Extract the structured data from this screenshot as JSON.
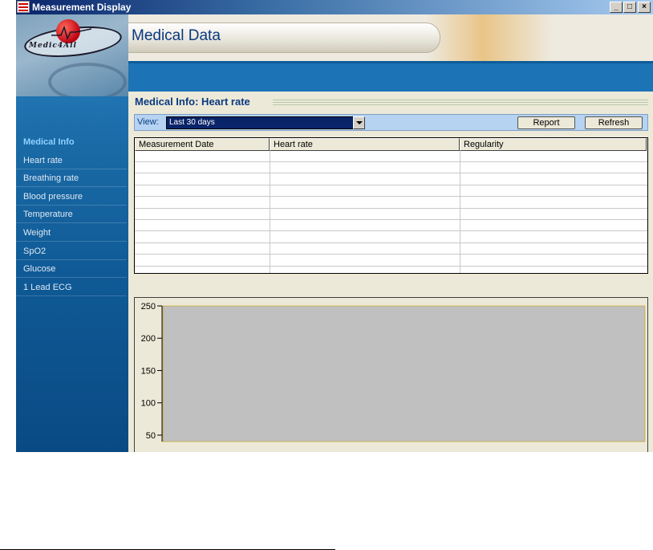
{
  "window": {
    "title": "Measurement Display",
    "controls": {
      "minimize": "_",
      "maximize": "□",
      "close": "×"
    }
  },
  "logo": {
    "text": "Medic4All"
  },
  "sidebar": {
    "items": [
      {
        "label": "Medical Info",
        "active": true
      },
      {
        "label": "Heart rate"
      },
      {
        "label": "Breathing rate"
      },
      {
        "label": "Blood pressure"
      },
      {
        "label": "Temperature"
      },
      {
        "label": "Weight"
      },
      {
        "label": "SpO2"
      },
      {
        "label": "Glucose"
      },
      {
        "label": "1 Lead ECG"
      }
    ]
  },
  "header": {
    "title": "Medical Data"
  },
  "section": {
    "title": "Medical Info: Heart rate"
  },
  "toolbar": {
    "view_label": "View:",
    "view_selected": "Last 30 days",
    "report_label": "Report",
    "refresh_label": "Refresh"
  },
  "table": {
    "columns": [
      "Measurement Date",
      "Heart rate",
      "Regularity"
    ],
    "rows": []
  },
  "chart_data": {
    "type": "line",
    "series": [],
    "y_ticks": [
      50,
      100,
      150,
      200,
      250
    ],
    "ylim": [
      40,
      250
    ],
    "plot_background": "#c0c0c0",
    "grid": false
  },
  "colors": {
    "accent": "#0a3a80",
    "sidebar": "#1a6aa6",
    "band": "#1c73b6",
    "selection": "#0a246a"
  }
}
